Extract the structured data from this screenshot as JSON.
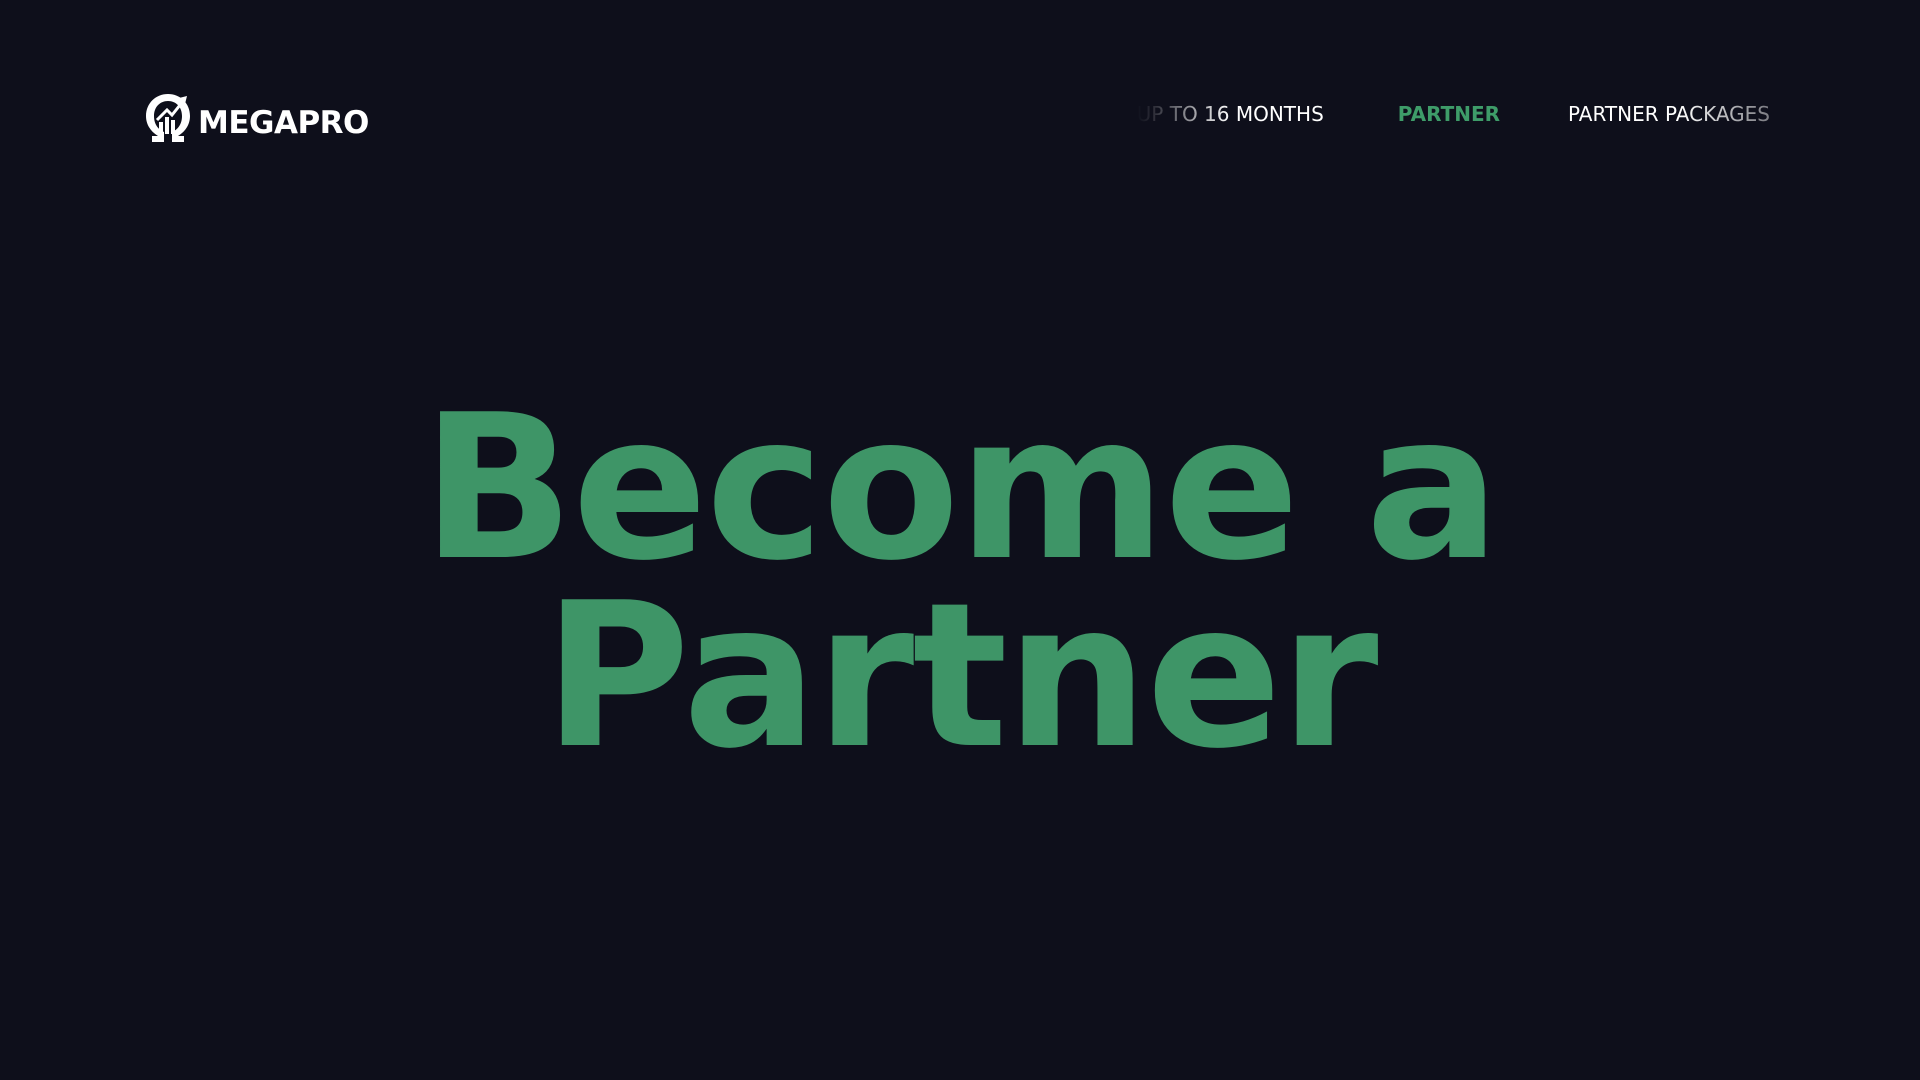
{
  "logo": {
    "text": "MEGAPRO",
    "icon": "omega-chart-logo-icon"
  },
  "nav": {
    "items": [
      {
        "label": "UP TO 16 MONTHS",
        "state": "partially-scrolled"
      },
      {
        "label": "PARTNER",
        "state": "active"
      },
      {
        "label": "PARTNER PACKAGES",
        "state": "default"
      }
    ]
  },
  "hero": {
    "line1": "Become a",
    "line2": "Partner"
  },
  "colors": {
    "background": "#0e0f1b",
    "accent": "#3e9567",
    "nav_active": "#3e9c69",
    "text": "#ffffff"
  }
}
